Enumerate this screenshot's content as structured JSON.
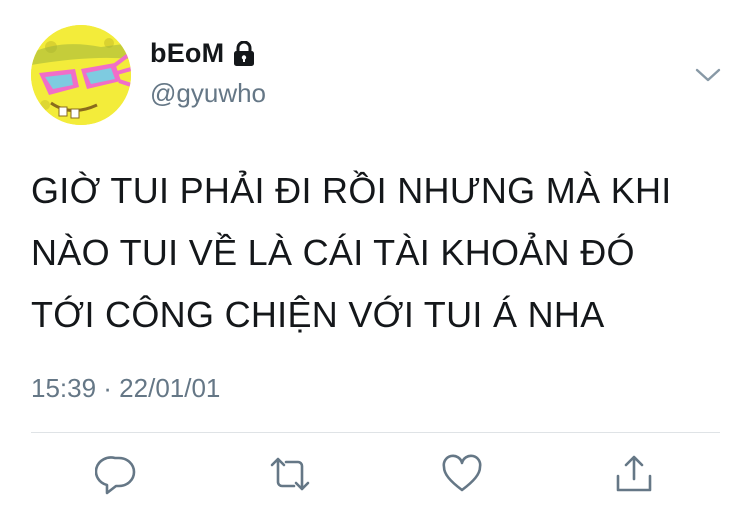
{
  "user": {
    "display_name": "bEoM",
    "handle": "@gyuwho",
    "protected_icon": "lock-icon",
    "avatar_icon": "avatar-yellow-character-pink-sunglasses"
  },
  "tweet": {
    "lines": [
      "GIỜ TUI PHẢI ĐI RỒI NHƯNG MÀ KHI",
      "NÀO TUI VỀ LÀ CÁI TÀI KHOẢN ĐÓ",
      "TỚI CÔNG CHIỆN VỚI TUI Á NHA"
    ],
    "timestamp": "15:39 · 22/01/01"
  },
  "actions": [
    "reply-icon",
    "retweet-icon",
    "like-icon",
    "share-icon"
  ],
  "colors": {
    "text": "#14171a",
    "secondary": "#657786",
    "icon": "#657786",
    "divider": "#dfe3e6",
    "avatar_bg": "#f3ec3a",
    "sunglasses": "#f06ec8"
  }
}
